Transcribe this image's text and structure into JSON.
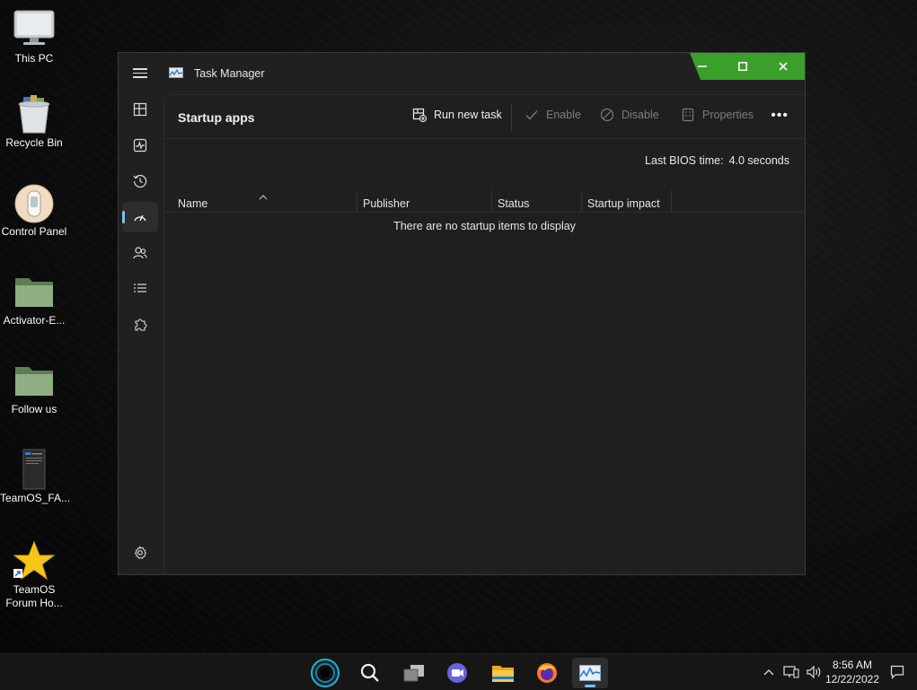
{
  "desktop": {
    "icons": [
      {
        "label": "This PC"
      },
      {
        "label": "Recycle Bin"
      },
      {
        "label": "Control Panel"
      },
      {
        "label": "Activator-E..."
      },
      {
        "label": "Follow us"
      },
      {
        "label": "TeamOS_FA..."
      },
      {
        "label": "TeamOS Forum Ho..."
      }
    ]
  },
  "window": {
    "title": "Task Manager",
    "page_title": "Startup apps",
    "toolbar": {
      "run_new_task": "Run new task",
      "enable": "Enable",
      "disable": "Disable",
      "properties": "Properties",
      "more": "•••"
    },
    "bios_label": "Last BIOS time:",
    "bios_value": "4.0 seconds",
    "columns": [
      "Name",
      "Publisher",
      "Status",
      "Startup impact"
    ],
    "empty_message": "There are no startup items to display",
    "nav_items": [
      "processes",
      "performance",
      "app-history",
      "startup-apps",
      "users",
      "details",
      "services",
      "settings"
    ]
  },
  "taskbar": {
    "time": "8:56 AM",
    "date": "12/22/2022"
  },
  "colors": {
    "accent": "#7cc0ea",
    "caption_green": "#3aa02a",
    "window_bg": "#202020"
  }
}
